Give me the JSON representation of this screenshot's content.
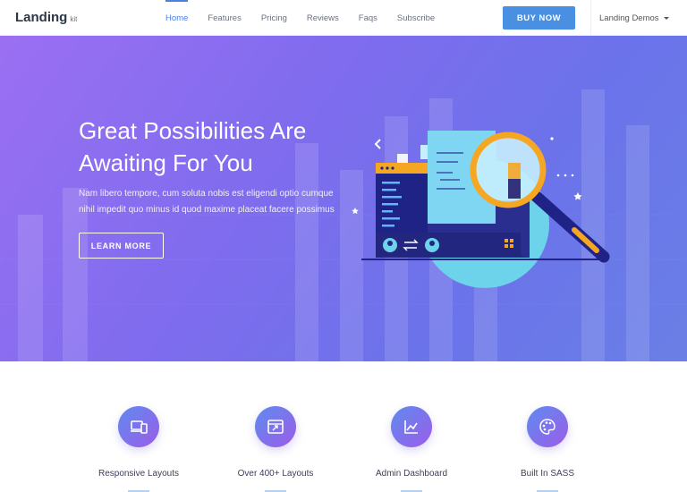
{
  "nav": {
    "brand": "Landing",
    "brand_sub": "kit",
    "links": [
      "Home",
      "Features",
      "Pricing",
      "Reviews",
      "Faqs",
      "Subscribe"
    ],
    "active_link": "Home",
    "buy_label": "BUY NOW",
    "demos_label": "Landing Demos"
  },
  "hero": {
    "title_line1": "Great Possibilities Are",
    "title_line2": "Awaiting For You",
    "desc_line1": "Nam libero tempore, cum soluta nobis est eligendi optio cumque",
    "desc_line2": "nihil impedit quo minus id quod maxime placeat facere possimus",
    "cta_label": "LEARN MORE"
  },
  "features": [
    {
      "label": "Responsive Layouts",
      "icon": "devices-icon"
    },
    {
      "label": "Over 400+ Layouts",
      "icon": "layout-window-icon"
    },
    {
      "label": "Admin Dashboard",
      "icon": "chart-line-icon"
    },
    {
      "label": "Built In SASS",
      "icon": "palette-icon"
    }
  ],
  "colors": {
    "accent": "#4a90e2",
    "active_link": "#4a7fe3",
    "hero_gradient_start": "#9b6ff2",
    "hero_gradient_end": "#6a7fe6",
    "feature_icon_start": "#5f8bf0",
    "feature_icon_end": "#9b5ce8"
  }
}
